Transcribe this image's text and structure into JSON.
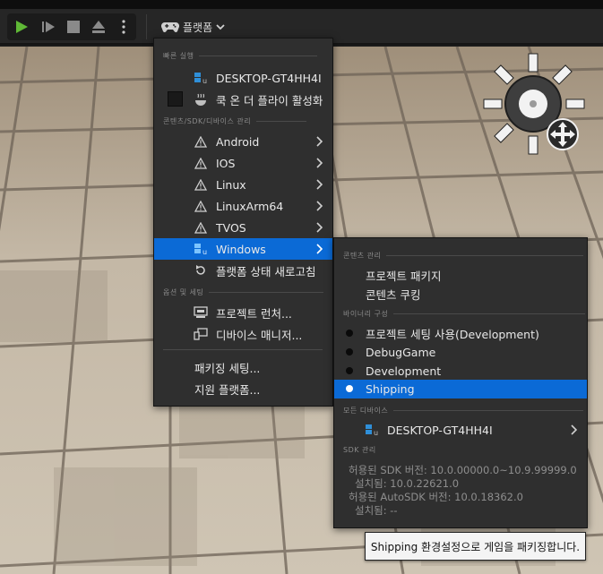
{
  "toolbar": {
    "platforms_label": "플랫폼"
  },
  "menu": {
    "quick_launch_header": "빠른 실행",
    "quick_device": "DESKTOP-GT4HH4I",
    "cook_on_fly": "쿡 온 더 플라이 활성화",
    "content_sdk_header": "콘텐츠/SDK/디바이스 관리",
    "platforms": [
      {
        "label": "Android"
      },
      {
        "label": "IOS"
      },
      {
        "label": "Linux"
      },
      {
        "label": "LinuxArm64"
      },
      {
        "label": "TVOS"
      },
      {
        "label": "Windows"
      }
    ],
    "refresh_status": "플랫폼 상태 새로고침",
    "options_header": "옵션 및 세팅",
    "project_launcher": "프로젝트 런처...",
    "device_manager": "디바이스 매니저...",
    "packaging_settings": "패키징 세팅...",
    "supported_platforms": "지원 플랫폼..."
  },
  "submenu": {
    "content_header": "콘텐츠 관리",
    "package_project": "프로젝트 패키지",
    "cook_content": "콘텐츠 쿠킹",
    "binary_header": "바이너리 구성",
    "configs": [
      {
        "label": "프로젝트 세팅 사용(Development)",
        "selected": false
      },
      {
        "label": "DebugGame",
        "selected": false
      },
      {
        "label": "Development",
        "selected": false
      },
      {
        "label": "Shipping",
        "selected": true
      }
    ],
    "devices_header": "모든 디바이스",
    "device": "DESKTOP-GT4HH4I",
    "sdk_header": "SDK 관리",
    "sdk_lines": [
      "허용된 SDK 버전: 10.0.00000.0~10.9.99999.0",
      "설치됨: 10.0.22621.0",
      "허용된 AutoSDK 버전: 10.0.18362.0",
      "설치됨: --"
    ]
  },
  "tooltip": "Shipping 환경설정으로 게임을 패키징합니다.",
  "colors": {
    "accent": "#0b6ad6",
    "play_green": "#5fb836",
    "menu_bg": "#2f2f2f"
  }
}
